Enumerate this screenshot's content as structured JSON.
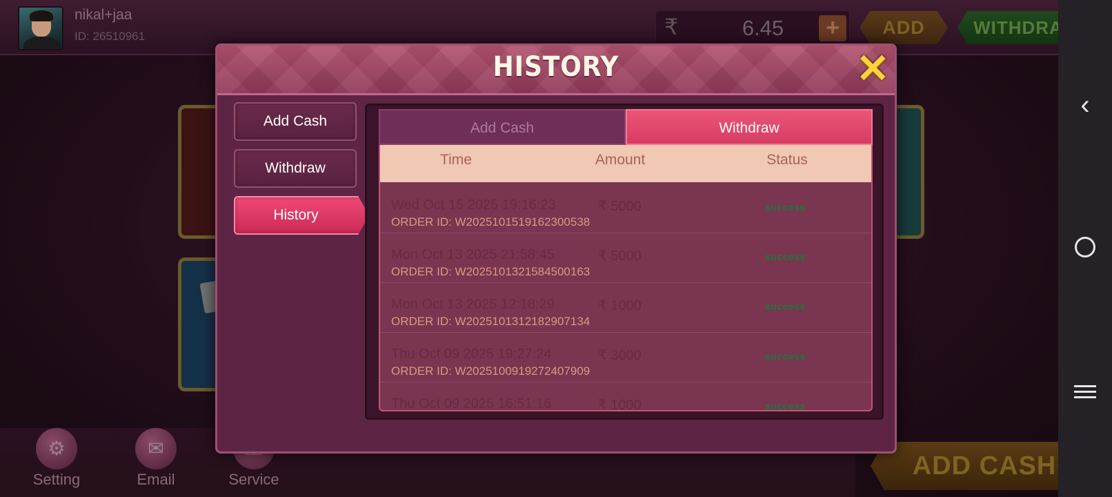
{
  "header": {
    "username": "nikal+jaa",
    "user_id": "ID: 26510961",
    "currency_icon": "rupee-icon",
    "balance": "6.45",
    "plus_label": "+",
    "add_label": "ADD",
    "withdraw_label": "WITHDRAW"
  },
  "bottom_nav": [
    {
      "label": "Setting",
      "icon": "gear-icon"
    },
    {
      "label": "Email",
      "icon": "mail-icon"
    },
    {
      "label": "Service",
      "icon": "headset-icon"
    }
  ],
  "add_cash_button": "ADD CASH",
  "modal": {
    "title": "HISTORY",
    "close_icon": "close-icon",
    "side_tabs": [
      {
        "label": "Add Cash",
        "active": false
      },
      {
        "label": "Withdraw",
        "active": false
      },
      {
        "label": "History",
        "active": true
      }
    ],
    "sub_tabs": [
      {
        "label": "Add Cash",
        "active": false
      },
      {
        "label": "Withdraw",
        "active": true
      }
    ],
    "columns": [
      "Time",
      "Amount",
      "Status"
    ],
    "rows": [
      {
        "time": "Wed Oct 15 2025 19:16:23",
        "amount": "₹ 5000",
        "status": "success",
        "order_id": "ORDER ID: W2025101519162300538"
      },
      {
        "time": "Mon Oct 13 2025 21:58:45",
        "amount": "₹ 5000",
        "status": "success",
        "order_id": "ORDER ID: W2025101321584500163"
      },
      {
        "time": "Mon Oct 13 2025 12:18:29",
        "amount": "₹ 1000",
        "status": "success",
        "order_id": "ORDER ID: W2025101312182907134"
      },
      {
        "time": "Thu Oct 09 2025 19:27:24",
        "amount": "₹ 3000",
        "status": "success",
        "order_id": "ORDER ID: W2025100919272407909"
      },
      {
        "time": "Thu Oct 09 2025 16:51:16",
        "amount": "₹ 1000",
        "status": "success",
        "order_id": ""
      }
    ]
  },
  "colors": {
    "modal_bg": "#5d2543",
    "active_tab": "#e23c66",
    "table_header_bg": "#f0c8b4",
    "status_success": "#1b7a3a"
  }
}
